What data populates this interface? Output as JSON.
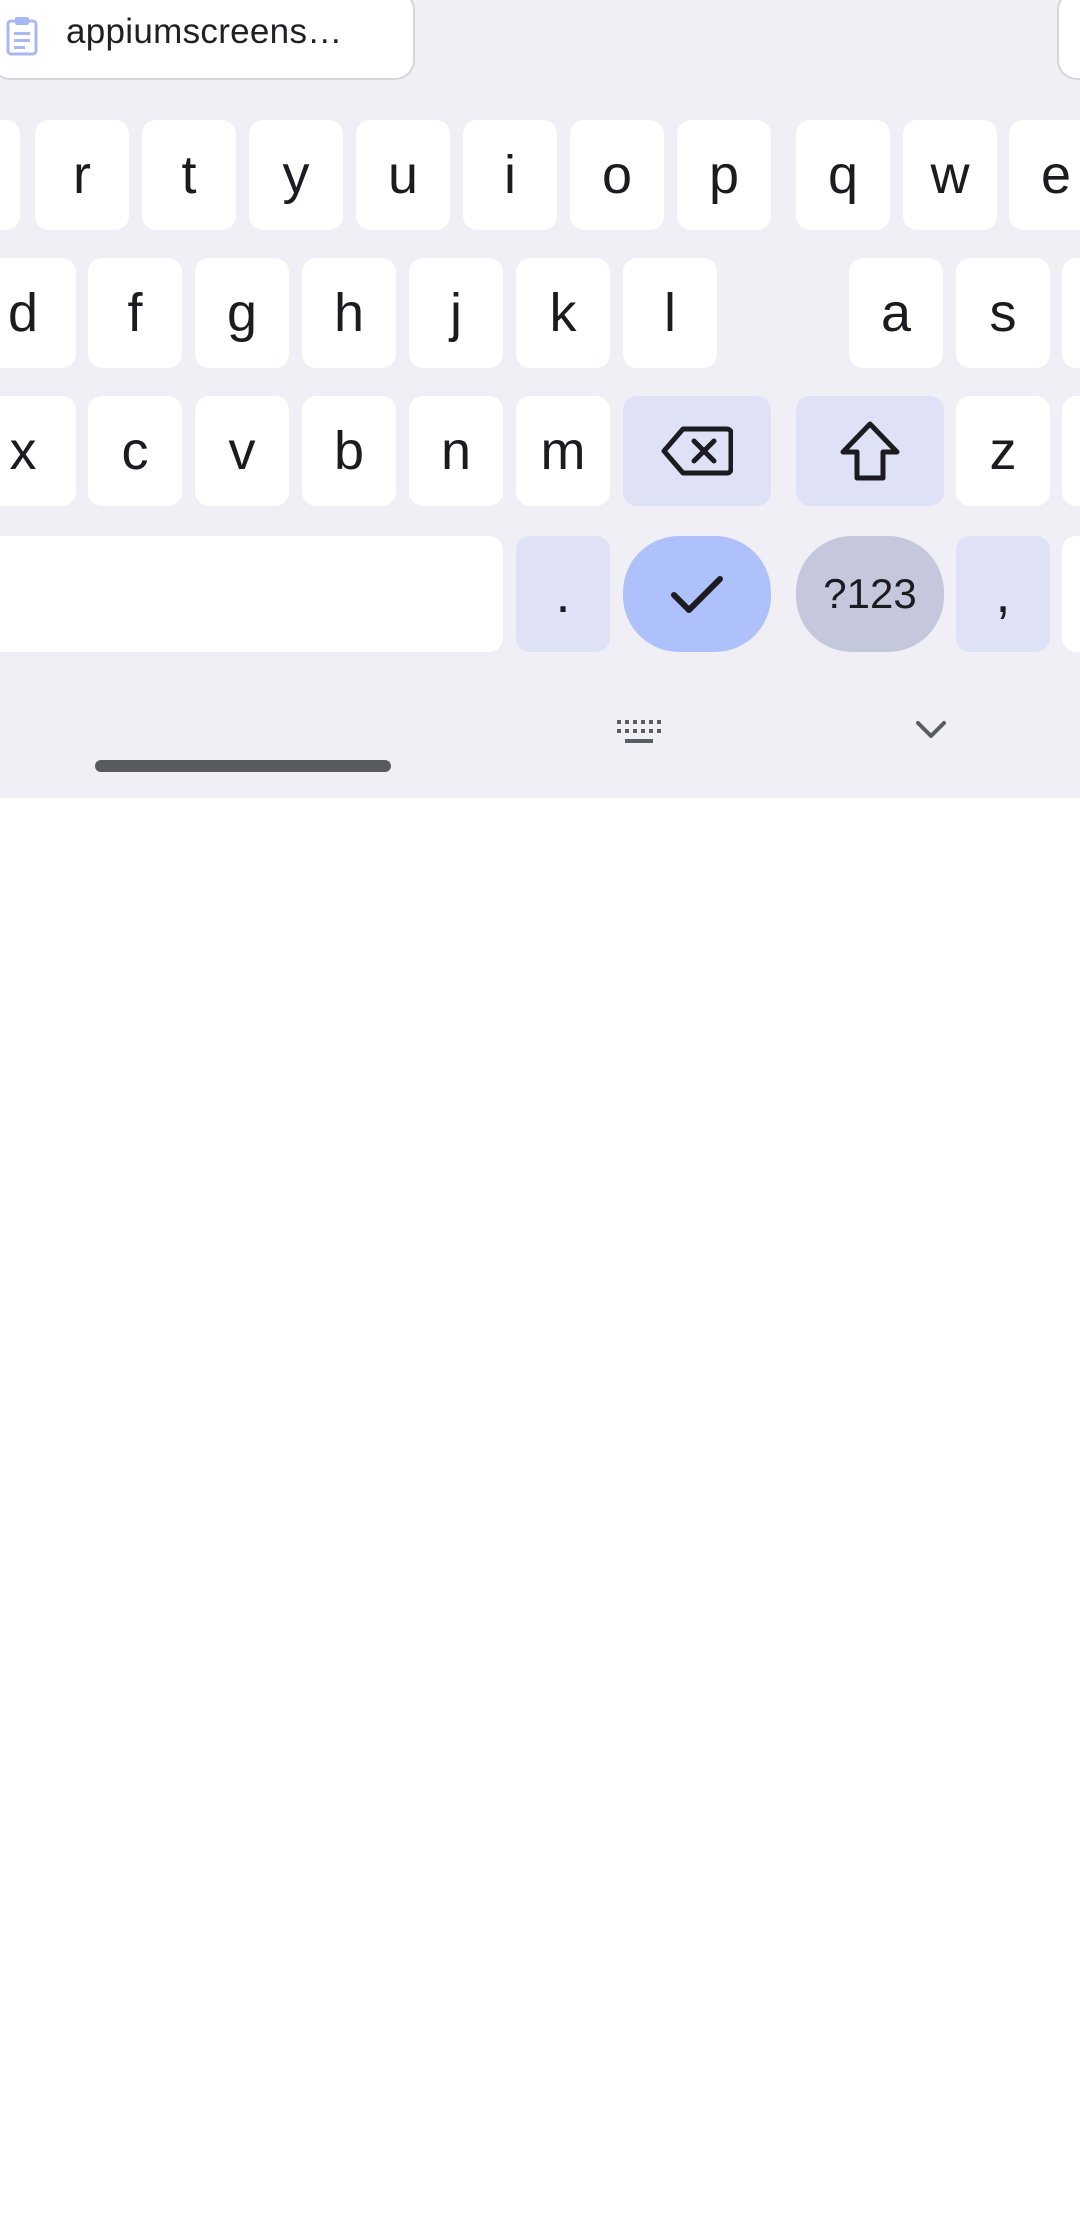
{
  "clipboard": {
    "suggestion": "appiumscreens…",
    "icon": "clipboard-icon"
  },
  "keyboard": {
    "row1": [
      "r",
      "t",
      "y",
      "u",
      "i",
      "o",
      "p",
      "q",
      "w",
      "e"
    ],
    "row2": [
      "d",
      "f",
      "g",
      "h",
      "j",
      "k",
      "l",
      "a",
      "s"
    ],
    "row3": [
      "x",
      "c",
      "v",
      "b",
      "n",
      "m",
      "z"
    ],
    "row4": {
      "period": ".",
      "symbols": "?123",
      "comma": ","
    },
    "icons": {
      "backspace": "backspace-icon",
      "enter": "checkmark-icon",
      "shift": "shift-arrow-icon",
      "keyboard_switch": "keyboard-icon",
      "hide": "chevron-down-icon"
    }
  },
  "colors": {
    "keyboard_bg": "#f0eff5",
    "key_bg": "#ffffff",
    "modifier_key_bg": "#dfe2f6",
    "enter_key_bg": "#aec1fb",
    "symbols_key_bg": "#c5c7dc",
    "clipboard_icon": "#a8b8f3"
  }
}
